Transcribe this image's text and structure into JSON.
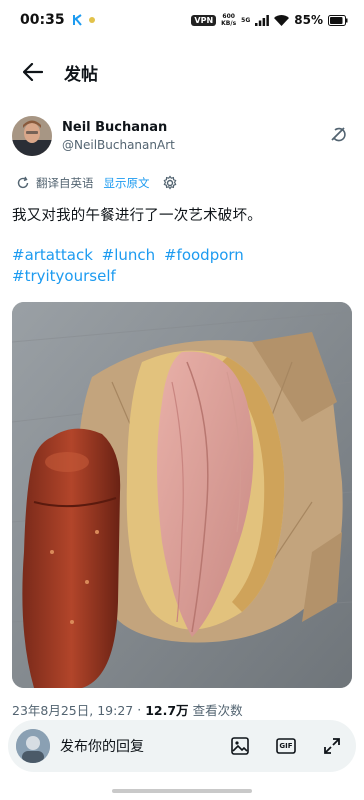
{
  "status_bar": {
    "time": "00:35",
    "vpn": "VPN",
    "speed_value": "600",
    "speed_unit": "KB/s",
    "network": "5G",
    "battery": "85%"
  },
  "header": {
    "title": "发帖"
  },
  "tweet": {
    "author_name": "Neil Buchanan",
    "author_handle": "@NeilBuchananArt",
    "translate_label": "翻译自英语",
    "show_original": "显示原文",
    "text": "我又对我的午餐进行了一次艺术破坏。",
    "hashtags": [
      "#artattack",
      "#lunch",
      "#foodporn",
      "#tryityourself"
    ],
    "timestamp": "23年8月25日, 19:27",
    "separator": "·",
    "view_count": "12.7万",
    "view_label": "查看次数"
  },
  "reply_bar": {
    "placeholder": "发布你的回复",
    "gif_label": "GIF"
  },
  "colors": {
    "accent": "#1d9bf0",
    "text_primary": "#0f1419",
    "text_secondary": "#536471",
    "reply_bg": "#eff3f4"
  }
}
